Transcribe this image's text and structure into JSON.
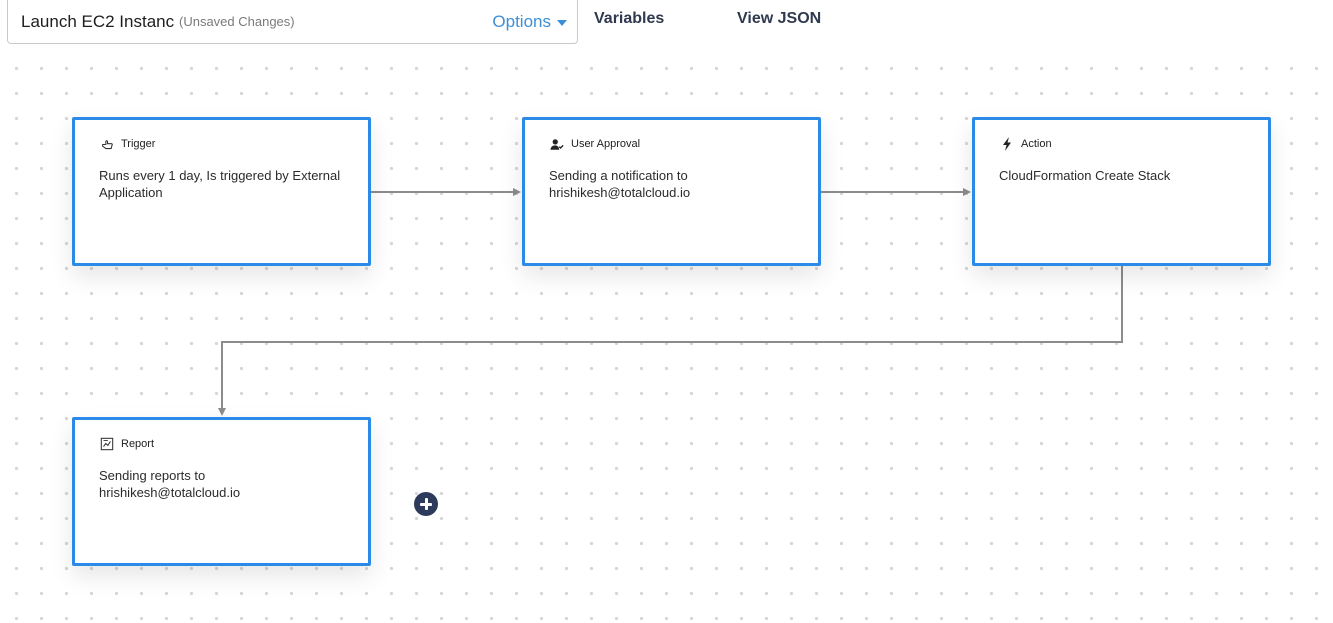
{
  "header": {
    "workflow_name": "Launch EC2 Instanc",
    "status": "(Unsaved Changes)",
    "options_label": "Options",
    "variables_label": "Variables",
    "view_json_label": "View JSON"
  },
  "nodes": {
    "trigger": {
      "title": "Trigger",
      "icon": "hand-pointer-icon",
      "body": "Runs every 1 day, Is triggered by External Application"
    },
    "approval": {
      "title": "User Approval",
      "icon": "user-check-icon",
      "body": "Sending a notification to hrishikesh@totalcloud.io"
    },
    "action": {
      "title": "Action",
      "icon": "lightning-bolt-icon",
      "body": "CloudFormation Create Stack"
    },
    "report": {
      "title": "Report",
      "icon": "report-document-icon",
      "body": "Sending reports to hrishikesh@totalcloud.io"
    }
  },
  "colors": {
    "node_border": "#2b8ae8",
    "accent_link": "#3d8fd6",
    "connector": "#8c8c8c",
    "add_button": "#2c3a5c"
  }
}
